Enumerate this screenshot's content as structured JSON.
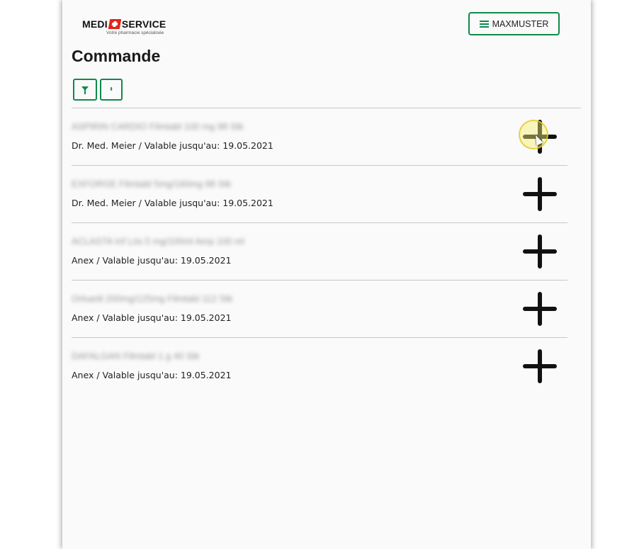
{
  "header": {
    "logo_text_left": "MEDI",
    "logo_text_right": "SERVICE",
    "logo_tagline": "Votre pharmacie spécialisée",
    "menu_label": "MAXMUSTER"
  },
  "page": {
    "title": "Commande"
  },
  "toolbar": {
    "filter_icon": "funnel-icon",
    "sort_icon": "sort-icon",
    "sort_glyph": "⬍"
  },
  "orders": [
    {
      "name": "ASPIRIN CARDIO Filmtabl 100 mg 98 Stk",
      "meta": "Dr. Med. Meier / Valable jusqu'au: 19.05.2021"
    },
    {
      "name": "EXFORGE Filmtabl 5mg/160mg 98 Stk",
      "meta": "Dr. Med. Meier / Valable jusqu'au: 19.05.2021"
    },
    {
      "name": "ACLASTA Inf Lös 5 mg/100ml Amp 100 ml",
      "meta": "Anex / Valable jusqu'au: 19.05.2021"
    },
    {
      "name": "Orlsartil 200mg/125mg Filmtabl 112 Stk",
      "meta": "Anex / Valable jusqu'au: 19.05.2021"
    },
    {
      "name": "DAFALGAN Filmtabl 1 g 40 Stk",
      "meta": "Anex / Valable jusqu'au: 19.05.2021"
    }
  ],
  "colors": {
    "accent": "#0f8a4a",
    "logo_red": "#e2231a",
    "cursor_highlight": "#f5f06e"
  }
}
